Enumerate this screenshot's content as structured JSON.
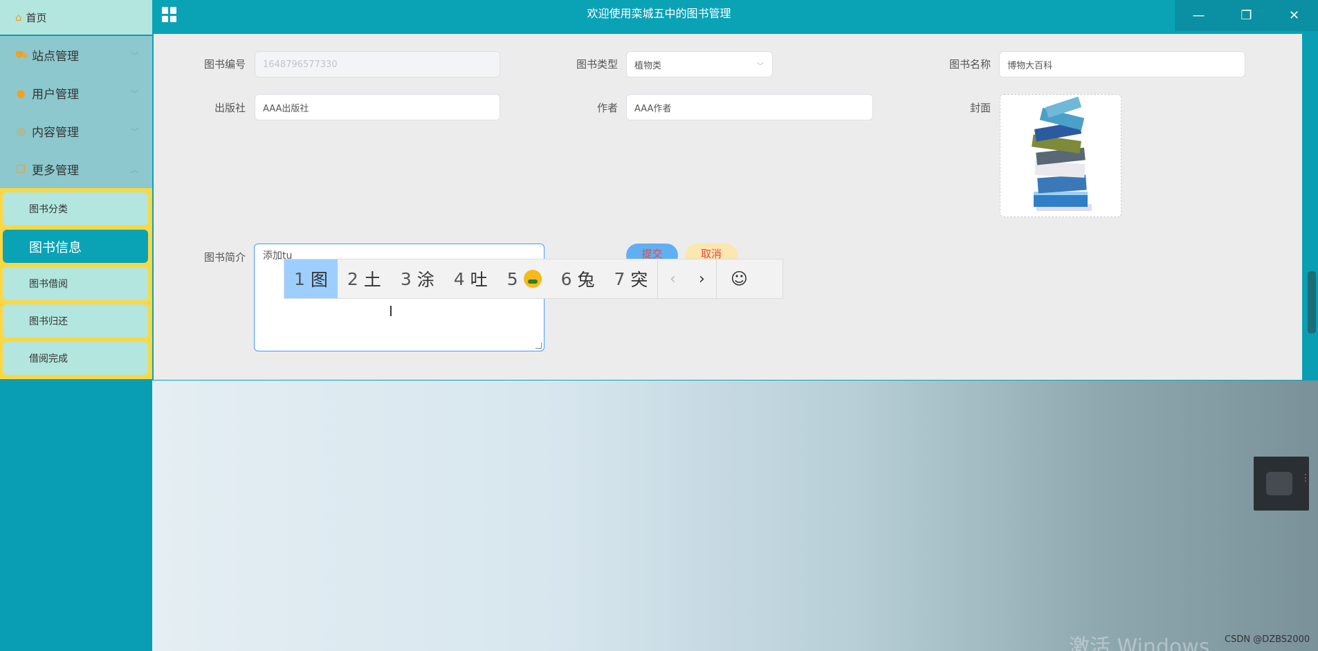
{
  "app": {
    "title": "欢迎使用栾城五中的图书管理"
  },
  "sidebar": {
    "home": "首页",
    "groups": [
      {
        "label": "站点管理",
        "icon": "cart-icon"
      },
      {
        "label": "用户管理",
        "icon": "user-icon"
      },
      {
        "label": "内容管理",
        "icon": "chat-icon"
      },
      {
        "label": "更多管理",
        "icon": "copy-icon"
      }
    ],
    "sub_items": [
      "图书分类",
      "图书信息",
      "图书借阅",
      "图书归还",
      "借阅完成"
    ],
    "active_sub": "图书信息"
  },
  "form": {
    "labels": {
      "book_no": "图书编号",
      "book_type": "图书类型",
      "book_name": "图书名称",
      "publisher": "出版社",
      "author": "作者",
      "cover": "封面",
      "intro": "图书简介"
    },
    "values": {
      "book_no": "1648796577330",
      "book_type": "植物类",
      "book_name": "博物大百科",
      "publisher": "AAA出版社",
      "author": "AAA作者",
      "intro": "添加tu"
    },
    "buttons": {
      "submit": "提交",
      "cancel": "取消"
    }
  },
  "ime": {
    "candidates": [
      {
        "n": "1",
        "text": "图"
      },
      {
        "n": "2",
        "text": "土"
      },
      {
        "n": "3",
        "text": "涂"
      },
      {
        "n": "4",
        "text": "吐"
      },
      {
        "n": "5",
        "text": ""
      },
      {
        "n": "6",
        "text": "兔"
      },
      {
        "n": "7",
        "text": "突"
      }
    ],
    "prev": "‹",
    "next": "›",
    "emoji": "☺"
  },
  "desktop": {
    "watermark": "激活 Windows",
    "credit": "CSDN @DZBS2000"
  },
  "colors": {
    "primary": "#0aa3b6",
    "menu_bg": "#8cc8cd",
    "sub_bg": "#b2e6de",
    "highlight": "#fbd843"
  }
}
